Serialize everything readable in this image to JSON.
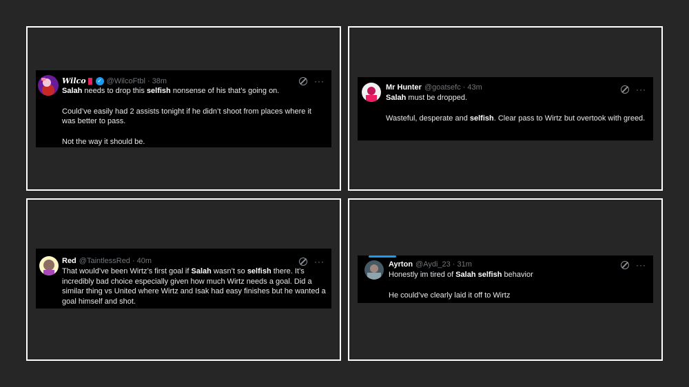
{
  "tweets": [
    {
      "name": "Wilco",
      "handle": "@WilcoFtbl",
      "time": "· 38m",
      "lines": [
        [
          {
            "t": "Salah",
            "b": true
          },
          {
            "t": " needs to drop this "
          },
          {
            "t": "selfish",
            "b": true
          },
          {
            "t": " nonsense of his that’s going on."
          }
        ],
        [],
        [
          {
            "t": "Could’ve easily had 2 assists tonight if he didn’t shoot from places where it was better to pass."
          }
        ],
        [],
        [
          {
            "t": "Not the way it should be."
          }
        ]
      ]
    },
    {
      "name": "Mr Hunter",
      "handle": "@goatsefc",
      "time": "· 43m",
      "lines": [
        [
          {
            "t": "Salah",
            "b": true
          },
          {
            "t": " must be dropped."
          }
        ],
        [],
        [
          {
            "t": "Wasteful, desperate and "
          },
          {
            "t": "selfish",
            "b": true
          },
          {
            "t": ". Clear pass to Wirtz but overtook with greed."
          }
        ]
      ]
    },
    {
      "name": "Red",
      "handle": "@TaintlessRed",
      "time": "· 40m",
      "lines": [
        [
          {
            "t": "That would’ve been Wirtz’s first goal if "
          },
          {
            "t": "Salah",
            "b": true
          },
          {
            "t": " wasn’t so "
          },
          {
            "t": "selfish",
            "b": true
          },
          {
            "t": " there. It’s incredibly bad choice especially given how much Wirtz needs a goal. Did a similar thing vs United where Wirtz and Isak had easy finishes but he wanted a goal himself and shot."
          }
        ]
      ]
    },
    {
      "name": "Ayrton",
      "handle": "@Aydi_23",
      "time": "· 31m",
      "lines": [
        [
          {
            "t": "Honestly im tired of "
          },
          {
            "t": "Salah",
            "b": true
          },
          {
            "t": " "
          },
          {
            "t": "selfish",
            "b": true
          },
          {
            "t": " behavior"
          }
        ],
        [],
        [
          {
            "t": "He could’ve clearly laid it off to Wirtz"
          }
        ]
      ]
    }
  ],
  "icons": {
    "grok": "grok-icon",
    "more": "more-icon",
    "verified": "verified-icon"
  },
  "colors": {
    "background": "#262626",
    "card": "#000000",
    "border": "#ffffff",
    "muted": "#71767b",
    "verified": "#1d9bf0"
  }
}
